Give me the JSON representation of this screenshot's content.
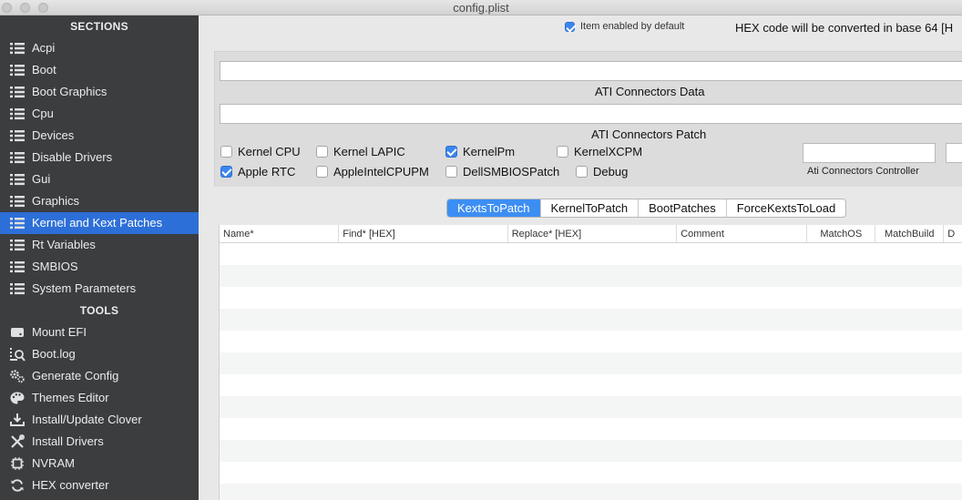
{
  "window": {
    "title": "config.plist"
  },
  "sidebar": {
    "sections_header": "SECTIONS",
    "sections": [
      {
        "label": "Acpi",
        "icon": "list-icon"
      },
      {
        "label": "Boot",
        "icon": "list-icon"
      },
      {
        "label": "Boot Graphics",
        "icon": "list-icon"
      },
      {
        "label": "Cpu",
        "icon": "list-icon"
      },
      {
        "label": "Devices",
        "icon": "list-icon"
      },
      {
        "label": "Disable Drivers",
        "icon": "list-icon"
      },
      {
        "label": "Gui",
        "icon": "list-icon"
      },
      {
        "label": "Graphics",
        "icon": "list-icon"
      },
      {
        "label": "Kernel and Kext Patches",
        "icon": "list-icon",
        "active": true
      },
      {
        "label": "Rt Variables",
        "icon": "list-icon"
      },
      {
        "label": "SMBIOS",
        "icon": "list-icon"
      },
      {
        "label": "System Parameters",
        "icon": "list-icon"
      }
    ],
    "tools_header": "TOOLS",
    "tools": [
      {
        "label": "Mount EFI",
        "icon": "disk-icon"
      },
      {
        "label": "Boot.log",
        "icon": "log-search-icon"
      },
      {
        "label": "Generate Config",
        "icon": "gears-icon"
      },
      {
        "label": "Themes Editor",
        "icon": "palette-icon"
      },
      {
        "label": "Install/Update Clover",
        "icon": "download-icon"
      },
      {
        "label": "Install Drivers",
        "icon": "tools-icon"
      },
      {
        "label": "NVRAM",
        "icon": "chip-icon"
      },
      {
        "label": "HEX converter",
        "icon": "refresh-icon"
      }
    ]
  },
  "main": {
    "item_enabled_label": "Item enabled by default",
    "item_enabled_checked": true,
    "hex_note": "HEX code will be converted in base 64 [H",
    "ati_connectors_data_label": "ATI Connectors Data",
    "ati_connectors_data_value": "",
    "ati_connectors_patch_label": "ATI Connectors Patch",
    "ati_connectors_patch_value": "",
    "options": [
      {
        "label": "Kernel CPU",
        "checked": false
      },
      {
        "label": "Kernel LAPIC",
        "checked": false
      },
      {
        "label": "KernelPm",
        "checked": true
      },
      {
        "label": "KernelXCPM",
        "checked": false
      },
      {
        "label": "Apple RTC",
        "checked": true
      },
      {
        "label": "AppleIntelCPUPM",
        "checked": false
      },
      {
        "label": "DellSMBIOSPatch",
        "checked": false
      },
      {
        "label": "Debug",
        "checked": false
      }
    ],
    "ati_connectors_controller_label": "Ati Connectors Controller",
    "ati_connectors_controller_value": "",
    "tabs": [
      {
        "label": "KextsToPatch",
        "active": true
      },
      {
        "label": "KernelToPatch"
      },
      {
        "label": "BootPatches"
      },
      {
        "label": "ForceKextsToLoad"
      }
    ],
    "table": {
      "columns": [
        "Name*",
        "Find* [HEX]",
        "Replace* [HEX]",
        "Comment",
        "MatchOS",
        "MatchBuild",
        "D"
      ],
      "rows": []
    }
  },
  "colors": {
    "sidebar_bg": "#3b3d3f",
    "selection": "#2d6fd8",
    "tab_active": "#3d8ef3",
    "checkbox_on": "#3b86ee"
  }
}
